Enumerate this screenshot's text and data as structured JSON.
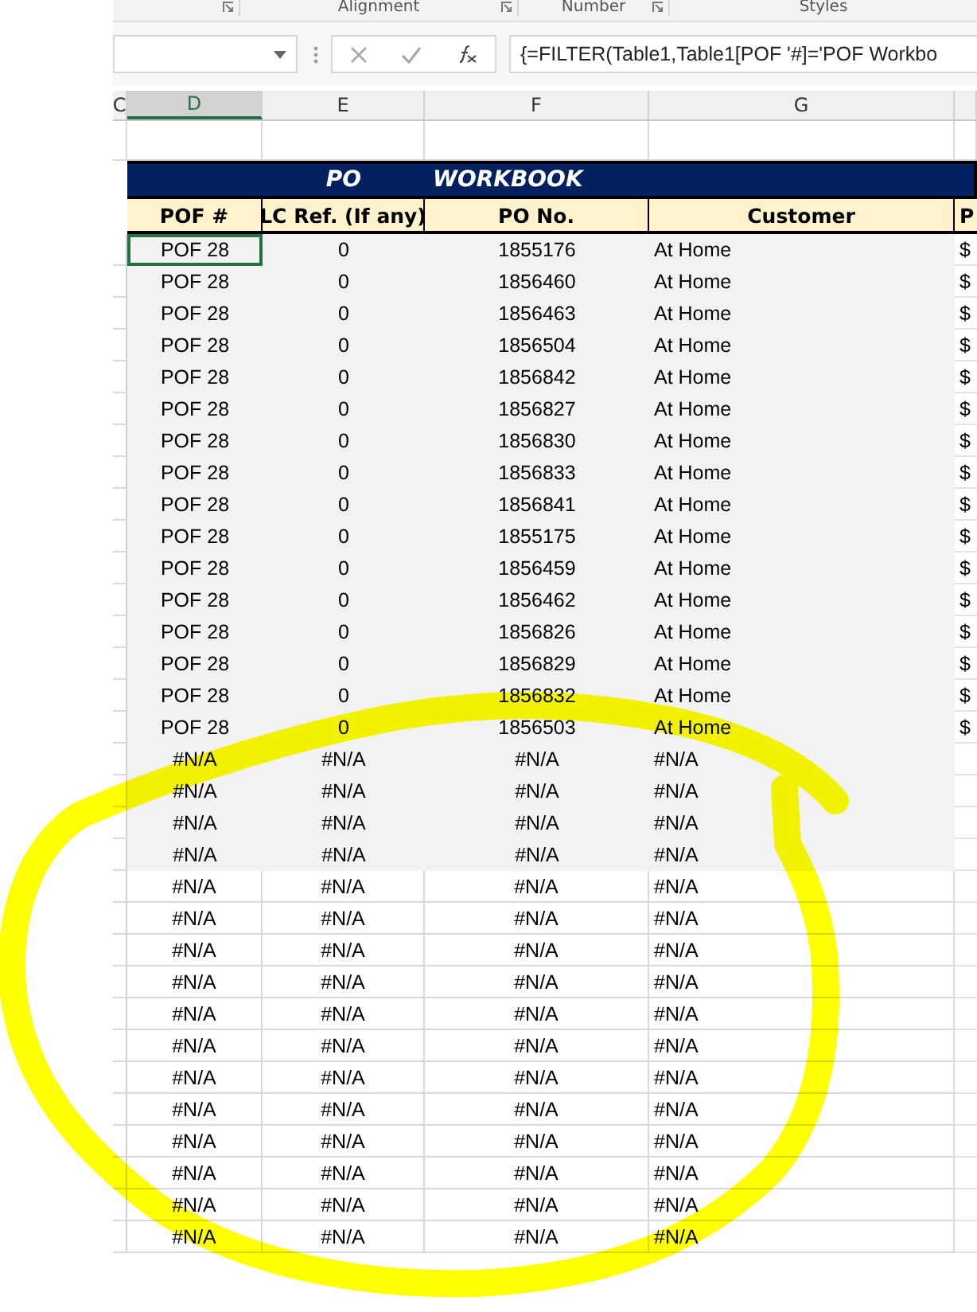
{
  "ribbon": {
    "groups": [
      {
        "label": "Alignment"
      },
      {
        "label": "Number"
      },
      {
        "label": "Styles"
      }
    ]
  },
  "formula_bar": {
    "formula": "{=FILTER(Table1,Table1[POF '#]='POF Workbo"
  },
  "column_headers": [
    {
      "label": "C",
      "selected": false
    },
    {
      "label": "D",
      "selected": true
    },
    {
      "label": "E",
      "selected": false
    },
    {
      "label": "F",
      "selected": false
    },
    {
      "label": "G",
      "selected": false
    }
  ],
  "title": {
    "left": "PO",
    "right": "WORKBOOK"
  },
  "table": {
    "columns": [
      "POF #",
      "LC Ref. (If any)",
      "PO No.",
      "Customer",
      "P"
    ],
    "rows": [
      {
        "cells": [
          "POF 28",
          "0",
          "1855176",
          "At Home",
          "$"
        ],
        "shaded": true,
        "selected": true
      },
      {
        "cells": [
          "POF 28",
          "0",
          "1856460",
          "At Home",
          "$"
        ],
        "shaded": true,
        "selected": false
      },
      {
        "cells": [
          "POF 28",
          "0",
          "1856463",
          "At Home",
          "$"
        ],
        "shaded": true,
        "selected": false
      },
      {
        "cells": [
          "POF 28",
          "0",
          "1856504",
          "At Home",
          "$"
        ],
        "shaded": true,
        "selected": false
      },
      {
        "cells": [
          "POF 28",
          "0",
          "1856842",
          "At Home",
          "$"
        ],
        "shaded": true,
        "selected": false
      },
      {
        "cells": [
          "POF 28",
          "0",
          "1856827",
          "At Home",
          "$"
        ],
        "shaded": true,
        "selected": false
      },
      {
        "cells": [
          "POF 28",
          "0",
          "1856830",
          "At Home",
          "$"
        ],
        "shaded": true,
        "selected": false
      },
      {
        "cells": [
          "POF 28",
          "0",
          "1856833",
          "At Home",
          "$"
        ],
        "shaded": true,
        "selected": false
      },
      {
        "cells": [
          "POF 28",
          "0",
          "1856841",
          "At Home",
          "$"
        ],
        "shaded": true,
        "selected": false
      },
      {
        "cells": [
          "POF 28",
          "0",
          "1855175",
          "At Home",
          "$"
        ],
        "shaded": true,
        "selected": false
      },
      {
        "cells": [
          "POF 28",
          "0",
          "1856459",
          "At Home",
          "$"
        ],
        "shaded": true,
        "selected": false
      },
      {
        "cells": [
          "POF 28",
          "0",
          "1856462",
          "At Home",
          "$"
        ],
        "shaded": true,
        "selected": false
      },
      {
        "cells": [
          "POF 28",
          "0",
          "1856826",
          "At Home",
          "$"
        ],
        "shaded": true,
        "selected": false
      },
      {
        "cells": [
          "POF 28",
          "0",
          "1856829",
          "At Home",
          "$"
        ],
        "shaded": true,
        "selected": false
      },
      {
        "cells": [
          "POF 28",
          "0",
          "1856832",
          "At Home",
          "$"
        ],
        "shaded": true,
        "selected": false
      },
      {
        "cells": [
          "POF 28",
          "0",
          "1856503",
          "At Home",
          "$"
        ],
        "shaded": true,
        "selected": false
      },
      {
        "cells": [
          "#N/A",
          "#N/A",
          "#N/A",
          "#N/A"
        ],
        "shaded": true,
        "selected": false
      },
      {
        "cells": [
          "#N/A",
          "#N/A",
          "#N/A",
          "#N/A"
        ],
        "shaded": true,
        "selected": false
      },
      {
        "cells": [
          "#N/A",
          "#N/A",
          "#N/A",
          "#N/A"
        ],
        "shaded": true,
        "selected": false
      },
      {
        "cells": [
          "#N/A",
          "#N/A",
          "#N/A",
          "#N/A"
        ],
        "shaded": true,
        "selected": false
      },
      {
        "cells": [
          "#N/A",
          "#N/A",
          "#N/A",
          "#N/A"
        ],
        "shaded": false,
        "selected": false
      },
      {
        "cells": [
          "#N/A",
          "#N/A",
          "#N/A",
          "#N/A"
        ],
        "shaded": false,
        "selected": false
      },
      {
        "cells": [
          "#N/A",
          "#N/A",
          "#N/A",
          "#N/A"
        ],
        "shaded": false,
        "selected": false
      },
      {
        "cells": [
          "#N/A",
          "#N/A",
          "#N/A",
          "#N/A"
        ],
        "shaded": false,
        "selected": false
      },
      {
        "cells": [
          "#N/A",
          "#N/A",
          "#N/A",
          "#N/A"
        ],
        "shaded": false,
        "selected": false
      },
      {
        "cells": [
          "#N/A",
          "#N/A",
          "#N/A",
          "#N/A"
        ],
        "shaded": false,
        "selected": false
      },
      {
        "cells": [
          "#N/A",
          "#N/A",
          "#N/A",
          "#N/A"
        ],
        "shaded": false,
        "selected": false
      },
      {
        "cells": [
          "#N/A",
          "#N/A",
          "#N/A",
          "#N/A"
        ],
        "shaded": false,
        "selected": false
      },
      {
        "cells": [
          "#N/A",
          "#N/A",
          "#N/A",
          "#N/A"
        ],
        "shaded": false,
        "selected": false
      },
      {
        "cells": [
          "#N/A",
          "#N/A",
          "#N/A",
          "#N/A"
        ],
        "shaded": false,
        "selected": false
      },
      {
        "cells": [
          "#N/A",
          "#N/A",
          "#N/A",
          "#N/A"
        ],
        "shaded": false,
        "selected": false
      },
      {
        "cells": [
          "#N/A",
          "#N/A",
          "#N/A",
          "#N/A"
        ],
        "shaded": false,
        "selected": false
      }
    ]
  },
  "annotation": {
    "kind": "freehand-loop"
  }
}
